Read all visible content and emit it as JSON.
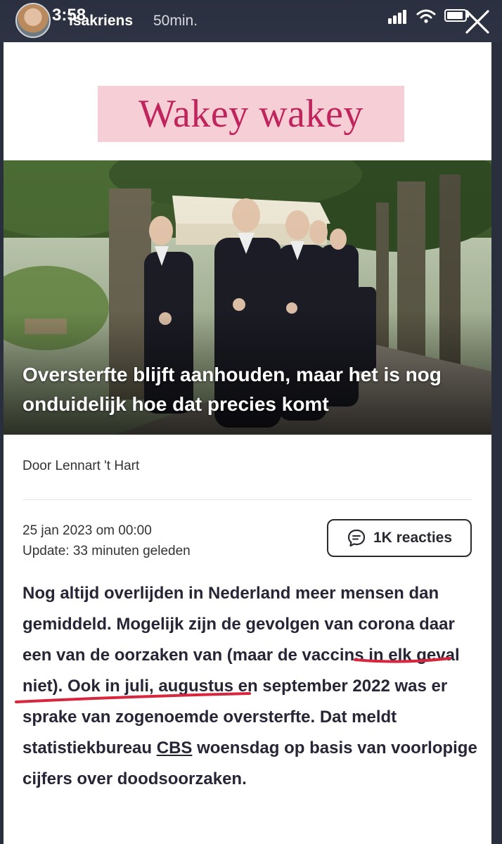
{
  "story": {
    "time": "3:58",
    "username": "isakriens",
    "time_ago": "50min."
  },
  "article": {
    "promo_banner": "Wakey wakey",
    "headline": "Oversterfte blijft aanhouden, maar het is nog onduidelijk hoe dat precies komt",
    "author": "Door Lennart 't Hart",
    "date": "25 jan 2023 om 00:00",
    "update": "Update: 33 minuten geleden",
    "reactions_label": "1K reacties",
    "body_part1": "Nog altijd overlijden in Nederland meer mensen dan gemiddeld. Mogelijk zijn de gevolgen van corona daar een van de oorzaken van (maar de vaccins in elk geval niet). Ook in juli, augustus en september 2022 was er sprake van zogenoemde oversterfte. Dat meldt statistiekbureau ",
    "body_link": "CBS",
    "body_part2": " woensdag op basis van voorlopige cijfers over doodsoorzaken."
  },
  "colors": {
    "promo_bg": "#f6cfd6",
    "promo_text": "#c0245c",
    "annotation": "#d7263d"
  },
  "icons": {
    "close": "close-icon",
    "comment": "comment-icon"
  }
}
